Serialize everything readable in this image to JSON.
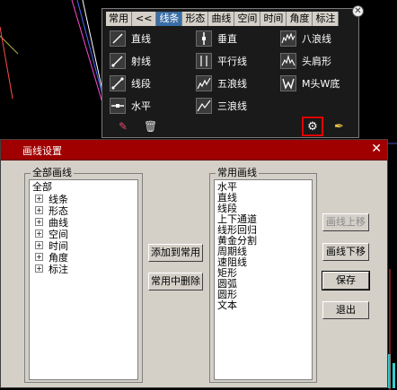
{
  "toolbar": {
    "tabs": [
      "常用",
      "<<",
      "线条",
      "形态",
      "曲线",
      "空间",
      "时间",
      "角度",
      "标注"
    ],
    "active_tab": "线条",
    "tools": [
      {
        "label": "直线",
        "icon": "line-icon"
      },
      {
        "label": "垂直",
        "icon": "vertical-line-icon"
      },
      {
        "label": "八浪线",
        "icon": "eight-wave-icon"
      },
      {
        "label": "射线",
        "icon": "ray-icon"
      },
      {
        "label": "平行线",
        "icon": "parallel-line-icon"
      },
      {
        "label": "头肩形",
        "icon": "head-shoulders-icon"
      },
      {
        "label": "线段",
        "icon": "segment-icon"
      },
      {
        "label": "五浪线",
        "icon": "five-wave-icon"
      },
      {
        "label": "M头W底",
        "icon": "m-top-w-bottom-icon"
      },
      {
        "label": "水平",
        "icon": "horizontal-line-icon"
      },
      {
        "label": "三浪线",
        "icon": "three-wave-icon"
      }
    ],
    "close_glyph": "✕"
  },
  "dialog": {
    "title": "画线设置",
    "close_glyph": "✕",
    "all_lines": {
      "legend": "全部画线",
      "root": "全部",
      "items": [
        "线条",
        "形态",
        "曲线",
        "空间",
        "时间",
        "角度",
        "标注"
      ]
    },
    "common_lines": {
      "legend": "常用画线",
      "items": [
        "水平",
        "直线",
        "线段",
        "上下通道",
        "线形回归",
        "黄金分割",
        "周期线",
        "速阻线",
        "矩形",
        "圆弧",
        "圆形",
        "文本"
      ]
    },
    "buttons": {
      "add": "添加到常用",
      "remove": "常用中删除",
      "move_up": "画线上移",
      "move_down": "画线下移",
      "save": "保存",
      "exit": "退出"
    }
  },
  "colors": {
    "dialog_title_bar": "#a00000",
    "active_tab": "#3a6ea5",
    "highlight_border": "#e00000"
  }
}
